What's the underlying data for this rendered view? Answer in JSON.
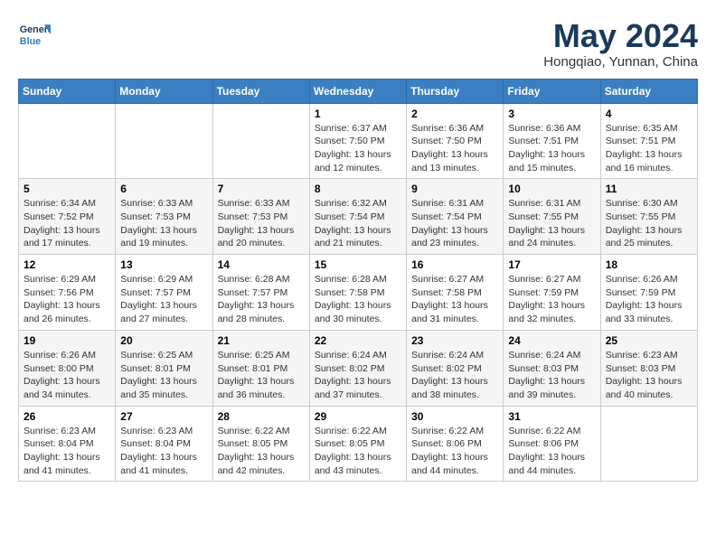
{
  "header": {
    "logo_line1": "General",
    "logo_line2": "Blue",
    "month_year": "May 2024",
    "location": "Hongqiao, Yunnan, China"
  },
  "weekdays": [
    "Sunday",
    "Monday",
    "Tuesday",
    "Wednesday",
    "Thursday",
    "Friday",
    "Saturday"
  ],
  "weeks": [
    [
      {
        "day": "",
        "info": ""
      },
      {
        "day": "",
        "info": ""
      },
      {
        "day": "",
        "info": ""
      },
      {
        "day": "1",
        "info": "Sunrise: 6:37 AM\nSunset: 7:50 PM\nDaylight: 13 hours and 12 minutes."
      },
      {
        "day": "2",
        "info": "Sunrise: 6:36 AM\nSunset: 7:50 PM\nDaylight: 13 hours and 13 minutes."
      },
      {
        "day": "3",
        "info": "Sunrise: 6:36 AM\nSunset: 7:51 PM\nDaylight: 13 hours and 15 minutes."
      },
      {
        "day": "4",
        "info": "Sunrise: 6:35 AM\nSunset: 7:51 PM\nDaylight: 13 hours and 16 minutes."
      }
    ],
    [
      {
        "day": "5",
        "info": "Sunrise: 6:34 AM\nSunset: 7:52 PM\nDaylight: 13 hours and 17 minutes."
      },
      {
        "day": "6",
        "info": "Sunrise: 6:33 AM\nSunset: 7:53 PM\nDaylight: 13 hours and 19 minutes."
      },
      {
        "day": "7",
        "info": "Sunrise: 6:33 AM\nSunset: 7:53 PM\nDaylight: 13 hours and 20 minutes."
      },
      {
        "day": "8",
        "info": "Sunrise: 6:32 AM\nSunset: 7:54 PM\nDaylight: 13 hours and 21 minutes."
      },
      {
        "day": "9",
        "info": "Sunrise: 6:31 AM\nSunset: 7:54 PM\nDaylight: 13 hours and 23 minutes."
      },
      {
        "day": "10",
        "info": "Sunrise: 6:31 AM\nSunset: 7:55 PM\nDaylight: 13 hours and 24 minutes."
      },
      {
        "day": "11",
        "info": "Sunrise: 6:30 AM\nSunset: 7:55 PM\nDaylight: 13 hours and 25 minutes."
      }
    ],
    [
      {
        "day": "12",
        "info": "Sunrise: 6:29 AM\nSunset: 7:56 PM\nDaylight: 13 hours and 26 minutes."
      },
      {
        "day": "13",
        "info": "Sunrise: 6:29 AM\nSunset: 7:57 PM\nDaylight: 13 hours and 27 minutes."
      },
      {
        "day": "14",
        "info": "Sunrise: 6:28 AM\nSunset: 7:57 PM\nDaylight: 13 hours and 28 minutes."
      },
      {
        "day": "15",
        "info": "Sunrise: 6:28 AM\nSunset: 7:58 PM\nDaylight: 13 hours and 30 minutes."
      },
      {
        "day": "16",
        "info": "Sunrise: 6:27 AM\nSunset: 7:58 PM\nDaylight: 13 hours and 31 minutes."
      },
      {
        "day": "17",
        "info": "Sunrise: 6:27 AM\nSunset: 7:59 PM\nDaylight: 13 hours and 32 minutes."
      },
      {
        "day": "18",
        "info": "Sunrise: 6:26 AM\nSunset: 7:59 PM\nDaylight: 13 hours and 33 minutes."
      }
    ],
    [
      {
        "day": "19",
        "info": "Sunrise: 6:26 AM\nSunset: 8:00 PM\nDaylight: 13 hours and 34 minutes."
      },
      {
        "day": "20",
        "info": "Sunrise: 6:25 AM\nSunset: 8:01 PM\nDaylight: 13 hours and 35 minutes."
      },
      {
        "day": "21",
        "info": "Sunrise: 6:25 AM\nSunset: 8:01 PM\nDaylight: 13 hours and 36 minutes."
      },
      {
        "day": "22",
        "info": "Sunrise: 6:24 AM\nSunset: 8:02 PM\nDaylight: 13 hours and 37 minutes."
      },
      {
        "day": "23",
        "info": "Sunrise: 6:24 AM\nSunset: 8:02 PM\nDaylight: 13 hours and 38 minutes."
      },
      {
        "day": "24",
        "info": "Sunrise: 6:24 AM\nSunset: 8:03 PM\nDaylight: 13 hours and 39 minutes."
      },
      {
        "day": "25",
        "info": "Sunrise: 6:23 AM\nSunset: 8:03 PM\nDaylight: 13 hours and 40 minutes."
      }
    ],
    [
      {
        "day": "26",
        "info": "Sunrise: 6:23 AM\nSunset: 8:04 PM\nDaylight: 13 hours and 41 minutes."
      },
      {
        "day": "27",
        "info": "Sunrise: 6:23 AM\nSunset: 8:04 PM\nDaylight: 13 hours and 41 minutes."
      },
      {
        "day": "28",
        "info": "Sunrise: 6:22 AM\nSunset: 8:05 PM\nDaylight: 13 hours and 42 minutes."
      },
      {
        "day": "29",
        "info": "Sunrise: 6:22 AM\nSunset: 8:05 PM\nDaylight: 13 hours and 43 minutes."
      },
      {
        "day": "30",
        "info": "Sunrise: 6:22 AM\nSunset: 8:06 PM\nDaylight: 13 hours and 44 minutes."
      },
      {
        "day": "31",
        "info": "Sunrise: 6:22 AM\nSunset: 8:06 PM\nDaylight: 13 hours and 44 minutes."
      },
      {
        "day": "",
        "info": ""
      }
    ]
  ]
}
